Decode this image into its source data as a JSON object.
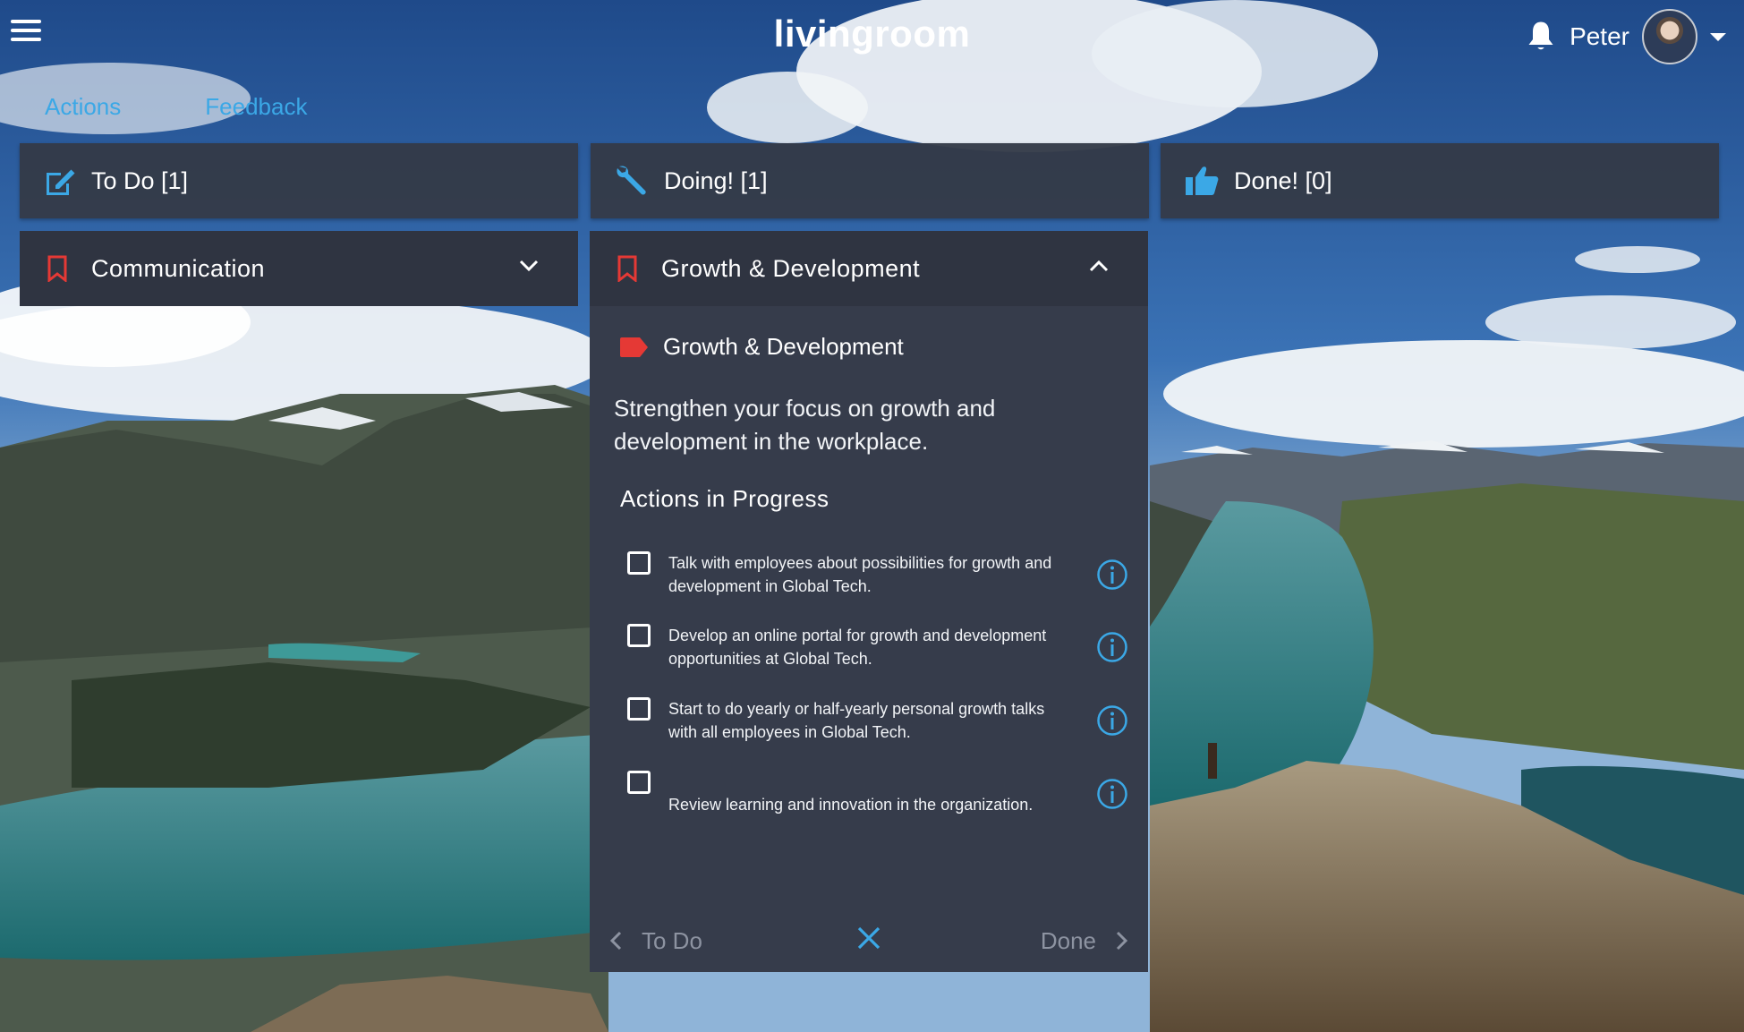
{
  "app": {
    "logo": "livingroom"
  },
  "header": {
    "user_name": "Peter"
  },
  "tabs": [
    {
      "label": "Actions"
    },
    {
      "label": "Feedback"
    }
  ],
  "columns": [
    {
      "label": "To Do [1]",
      "icon": "edit-icon"
    },
    {
      "label": "Doing! [1]",
      "icon": "wrench-icon"
    },
    {
      "label": "Done! [0]",
      "icon": "thumbs-up-icon"
    }
  ],
  "categories": [
    {
      "label": "Communication",
      "expanded": false
    },
    {
      "label": "Growth & Development",
      "expanded": true
    }
  ],
  "panel": {
    "tag_label": "Growth & Development",
    "description": "Strengthen your focus on growth and development in the workplace.",
    "section_title": "Actions in Progress",
    "actions": [
      {
        "text": "Talk with employees about possibilities for growth and development in Global Tech.",
        "checked": false
      },
      {
        "text": "Develop an online portal for growth and development opportunities at Global Tech.",
        "checked": false
      },
      {
        "text": "Start to do yearly or half-yearly personal growth talks with all employees in Global Tech.",
        "checked": false
      },
      {
        "text": "Review learning and innovation in the organization.",
        "checked": false
      }
    ],
    "nav": {
      "prev_label": "To Do",
      "next_label": "Done"
    }
  },
  "colors": {
    "accent": "#3ba8e6",
    "bookmark": "#e53935",
    "card_bg": "#363c4b",
    "header_bg": "#343a48"
  }
}
